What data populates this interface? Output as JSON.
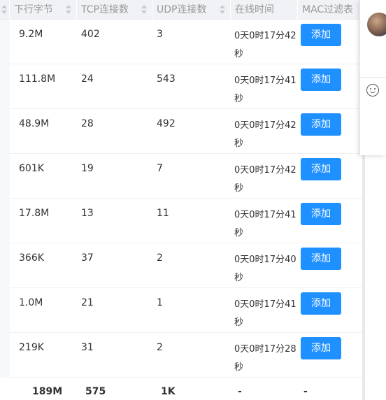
{
  "table": {
    "columns": [
      {
        "key": "down_bytes",
        "label": "下行字节"
      },
      {
        "key": "tcp",
        "label": "TCP连接数"
      },
      {
        "key": "udp",
        "label": "UDP连接数"
      },
      {
        "key": "online",
        "label": "在线时间"
      },
      {
        "key": "mac",
        "label": "MAC过滤表"
      }
    ],
    "rows": [
      {
        "down_bytes": "9.2M",
        "tcp": "402",
        "udp": "3",
        "online": "0天0时17分42秒",
        "action": "添加"
      },
      {
        "down_bytes": "111.8M",
        "tcp": "24",
        "udp": "543",
        "online": "0天0时17分41秒",
        "action": "添加"
      },
      {
        "down_bytes": "48.9M",
        "tcp": "28",
        "udp": "492",
        "online": "0天0时17分42秒",
        "action": "添加"
      },
      {
        "down_bytes": "601K",
        "tcp": "19",
        "udp": "7",
        "online": "0天0时17分42秒",
        "action": "添加"
      },
      {
        "down_bytes": "17.8M",
        "tcp": "13",
        "udp": "11",
        "online": "0天0时17分41秒",
        "action": "添加"
      },
      {
        "down_bytes": "366K",
        "tcp": "37",
        "udp": "2",
        "online": "0天0时17分40秒",
        "action": "添加"
      },
      {
        "down_bytes": "1.0M",
        "tcp": "21",
        "udp": "1",
        "online": "0天0时17分41秒",
        "action": "添加"
      },
      {
        "down_bytes": "219K",
        "tcp": "31",
        "udp": "2",
        "online": "0天0时17分28秒",
        "action": "添加"
      }
    ],
    "totals": {
      "down_bytes": "189M",
      "tcp": "575",
      "udp": "1K",
      "online": "-",
      "mac": "-"
    }
  },
  "side_panel": {
    "avatar": "user-avatar",
    "emoji": "emoji-icon"
  },
  "colors": {
    "header_bg": "#f0f2f5",
    "header_text": "#999999",
    "button_bg": "#1e90ff",
    "button_text": "#ffffff"
  }
}
